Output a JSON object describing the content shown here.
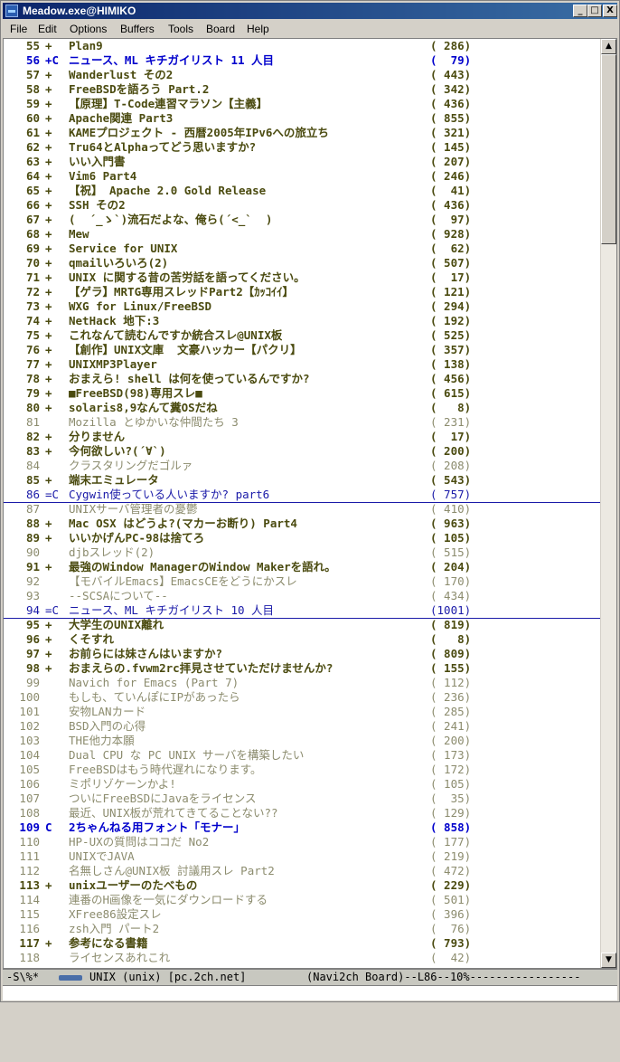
{
  "window": {
    "title": "Meadow.exe@HIMIKO",
    "buttons": [
      "_",
      "□",
      "X"
    ]
  },
  "menu": [
    "File",
    "Edit",
    "Options",
    "Buffers",
    "Tools",
    "Board",
    "Help"
  ],
  "threads": [
    {
      "num": "55",
      "mark": "+",
      "title": "Plan9",
      "count": "( 286)",
      "state": "unread"
    },
    {
      "num": "56",
      "mark": "+C",
      "title": "ニュース、ML キチガイリスト 11 人目",
      "count": "(  79)",
      "state": "cur"
    },
    {
      "num": "57",
      "mark": "+",
      "title": "Wanderlust その2",
      "count": "( 443)",
      "state": "unread"
    },
    {
      "num": "58",
      "mark": "+",
      "title": "FreeBSDを語ろう Part.2",
      "count": "( 342)",
      "state": "unread"
    },
    {
      "num": "59",
      "mark": "+",
      "title": "【原理】T-Code連習マラソン【主義】",
      "count": "( 436)",
      "state": "unread"
    },
    {
      "num": "60",
      "mark": "+",
      "title": "Apache関連 Part3",
      "count": "( 855)",
      "state": "unread"
    },
    {
      "num": "61",
      "mark": "+",
      "title": "KAMEプロジェクト - 西暦2005年IPv6への旅立ち",
      "count": "( 321)",
      "state": "unread"
    },
    {
      "num": "62",
      "mark": "+",
      "title": "Tru64とAlphaってどう思いますか?",
      "count": "( 145)",
      "state": "unread"
    },
    {
      "num": "63",
      "mark": "+",
      "title": "いい入門書",
      "count": "( 207)",
      "state": "unread"
    },
    {
      "num": "64",
      "mark": "+",
      "title": "Vim6 Part4",
      "count": "( 246)",
      "state": "unread"
    },
    {
      "num": "65",
      "mark": "+",
      "title": "【祝】 Apache 2.0 Gold Release",
      "count": "(  41)",
      "state": "unread"
    },
    {
      "num": "66",
      "mark": "+",
      "title": "SSH その2",
      "count": "( 436)",
      "state": "unread"
    },
    {
      "num": "67",
      "mark": "+",
      "title": "(  ´_ゝ`)流石だよな、俺ら(´<_`  )",
      "count": "(  97)",
      "state": "unread"
    },
    {
      "num": "68",
      "mark": "+",
      "title": "Mew",
      "count": "( 928)",
      "state": "unread"
    },
    {
      "num": "69",
      "mark": "+",
      "title": "Service for UNIX",
      "count": "(  62)",
      "state": "unread"
    },
    {
      "num": "70",
      "mark": "+",
      "title": "qmailいろいろ(2)",
      "count": "( 507)",
      "state": "unread"
    },
    {
      "num": "71",
      "mark": "+",
      "title": "UNIX に関する昔の苦労話を語ってください。",
      "count": "(  17)",
      "state": "unread"
    },
    {
      "num": "72",
      "mark": "+",
      "title": "【ゲラ】MRTG専用スレッドPart2【ｶｯｺｲｲ】",
      "count": "( 121)",
      "state": "unread"
    },
    {
      "num": "73",
      "mark": "+",
      "title": "WXG for Linux/FreeBSD",
      "count": "( 294)",
      "state": "unread"
    },
    {
      "num": "74",
      "mark": "+",
      "title": "NetHack 地下:3",
      "count": "( 192)",
      "state": "unread"
    },
    {
      "num": "75",
      "mark": "+",
      "title": "これなんて読むんですか統合スレ@UNIX板",
      "count": "( 525)",
      "state": "unread"
    },
    {
      "num": "76",
      "mark": "+",
      "title": "【創作】UNIX文庫  文豪ハッカー【パクリ】",
      "count": "( 357)",
      "state": "unread"
    },
    {
      "num": "77",
      "mark": "+",
      "title": "UNIXMP3Player",
      "count": "( 138)",
      "state": "unread"
    },
    {
      "num": "78",
      "mark": "+",
      "title": "おまえら! shell は何を使っているんですか?",
      "count": "( 456)",
      "state": "unread"
    },
    {
      "num": "79",
      "mark": "+",
      "title": "■FreeBSD(98)専用スレ■",
      "count": "( 615)",
      "state": "unread"
    },
    {
      "num": "80",
      "mark": "+",
      "title": "solaris8,9なんて糞OSだね",
      "count": "(   8)",
      "state": "unread"
    },
    {
      "num": "81",
      "mark": "",
      "title": "Mozilla とゆかいな仲間たち 3",
      "count": "( 231)",
      "state": "read"
    },
    {
      "num": "82",
      "mark": "+",
      "title": "分りません",
      "count": "(  17)",
      "state": "unread"
    },
    {
      "num": "83",
      "mark": "+",
      "title": "今何欲しい?(´∀`)",
      "count": "( 200)",
      "state": "unread"
    },
    {
      "num": "84",
      "mark": "",
      "title": "クラスタリングだゴルァ",
      "count": "( 208)",
      "state": "read"
    },
    {
      "num": "85",
      "mark": "+",
      "title": "端末エミュレータ",
      "count": "( 543)",
      "state": "unread"
    },
    {
      "num": "86",
      "mark": "=C",
      "title": "Cygwin使っている人いますか? part6",
      "count": "( 757)",
      "state": "sel"
    },
    {
      "num": "87",
      "mark": "",
      "title": "UNIXサーバ管理者の憂鬱",
      "count": "( 410)",
      "state": "read"
    },
    {
      "num": "88",
      "mark": "+",
      "title": "Mac OSX はどうよ?(マカーお断り) Part4",
      "count": "( 963)",
      "state": "unread"
    },
    {
      "num": "89",
      "mark": "+",
      "title": "いいかげんPC-98は捨てろ",
      "count": "( 105)",
      "state": "unread"
    },
    {
      "num": "90",
      "mark": "",
      "title": "djbスレッド(2)",
      "count": "( 515)",
      "state": "read"
    },
    {
      "num": "91",
      "mark": "+",
      "title": "最強のWindow ManagerのWindow Makerを語れ。",
      "count": "( 204)",
      "state": "unread"
    },
    {
      "num": "92",
      "mark": "",
      "title": "【モバイルEmacs】EmacsCEをどうにかスレ",
      "count": "( 170)",
      "state": "read"
    },
    {
      "num": "93",
      "mark": "",
      "title": "--SCSAについて--",
      "count": "( 434)",
      "state": "read"
    },
    {
      "num": "94",
      "mark": "=C",
      "title": "ニュース、ML キチガイリスト 10 人目",
      "count": "(1001)",
      "state": "sel"
    },
    {
      "num": "95",
      "mark": "+",
      "title": "大学生のUNIX離れ",
      "count": "( 819)",
      "state": "unread"
    },
    {
      "num": "96",
      "mark": "+",
      "title": "くそすれ",
      "count": "(   8)",
      "state": "unread"
    },
    {
      "num": "97",
      "mark": "+",
      "title": "お前らには妹さんはいますか?",
      "count": "( 809)",
      "state": "unread"
    },
    {
      "num": "98",
      "mark": "+",
      "title": "おまえらの.fvwm2rc拝見させていただけませんか?",
      "count": "( 155)",
      "state": "unread"
    },
    {
      "num": "99",
      "mark": "",
      "title": "Navich for Emacs (Part 7)",
      "count": "( 112)",
      "state": "read"
    },
    {
      "num": "100",
      "mark": "",
      "title": "もしも、ていんぽにIPがあったら",
      "count": "( 236)",
      "state": "read"
    },
    {
      "num": "101",
      "mark": "",
      "title": "安物LANカード",
      "count": "( 285)",
      "state": "read"
    },
    {
      "num": "102",
      "mark": "",
      "title": "BSD入門の心得",
      "count": "( 241)",
      "state": "read"
    },
    {
      "num": "103",
      "mark": "",
      "title": "THE他力本願",
      "count": "( 200)",
      "state": "read"
    },
    {
      "num": "104",
      "mark": "",
      "title": "Dual CPU な PC UNIX サーバを構築したい",
      "count": "( 173)",
      "state": "read"
    },
    {
      "num": "105",
      "mark": "",
      "title": "FreeBSDはもう時代遅れになります。",
      "count": "( 172)",
      "state": "read"
    },
    {
      "num": "106",
      "mark": "",
      "title": "ミポリゾケーンかよ!",
      "count": "( 105)",
      "state": "read"
    },
    {
      "num": "107",
      "mark": "",
      "title": "ついにFreeBSDにJavaをライセンス",
      "count": "(  35)",
      "state": "read"
    },
    {
      "num": "108",
      "mark": "",
      "title": "最近、UNIX板が荒れてきてることない??",
      "count": "( 129)",
      "state": "read"
    },
    {
      "num": "109",
      "mark": "C",
      "title": "2ちゃんねる用フォント「モナー」",
      "count": "( 858)",
      "state": "sel2"
    },
    {
      "num": "110",
      "mark": "",
      "title": "HP-UXの質問はココだ No2",
      "count": "( 177)",
      "state": "read"
    },
    {
      "num": "111",
      "mark": "",
      "title": "UNIXでJAVA",
      "count": "( 219)",
      "state": "read"
    },
    {
      "num": "112",
      "mark": "",
      "title": "名無しさん@UNIX板 討議用スレ Part2",
      "count": "( 472)",
      "state": "read"
    },
    {
      "num": "113",
      "mark": "+",
      "title": "unixユーザーのたべもの",
      "count": "( 229)",
      "state": "unread"
    },
    {
      "num": "114",
      "mark": "",
      "title": "連番のH画像を一気にダウンロードする",
      "count": "( 501)",
      "state": "read"
    },
    {
      "num": "115",
      "mark": "",
      "title": "XFree86設定スレ",
      "count": "( 396)",
      "state": "read"
    },
    {
      "num": "116",
      "mark": "",
      "title": "zsh入門 パート2",
      "count": "(  76)",
      "state": "read"
    },
    {
      "num": "117",
      "mark": "+",
      "title": "参考になる書籍",
      "count": "( 793)",
      "state": "unread"
    },
    {
      "num": "118",
      "mark": "",
      "title": "ライセンスあれこれ",
      "count": "(  42)",
      "state": "read"
    }
  ],
  "modeline": {
    "left": "-S\\%*",
    "buffer": "UNIX (unix) [pc.2ch.net]",
    "right": "(Navi2ch Board)--L86--10%-----------------"
  },
  "colors": {
    "titlebar": "#0a246a",
    "unread": "#4b4b10",
    "read": "#8c8c6e",
    "current": "#0000cc"
  }
}
